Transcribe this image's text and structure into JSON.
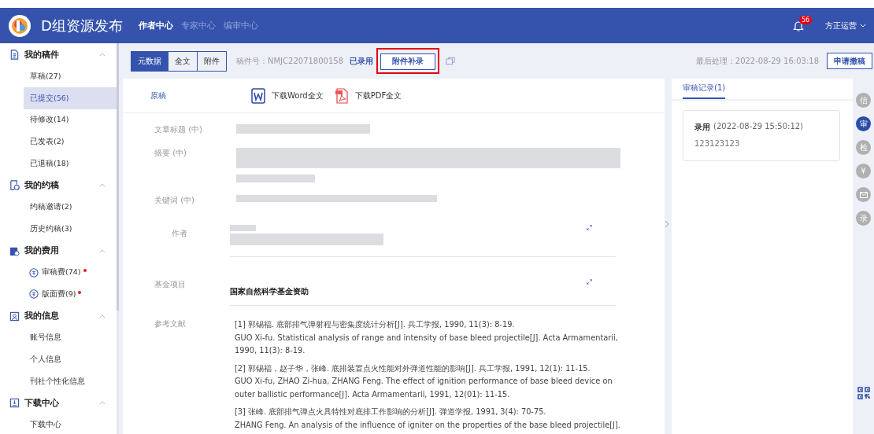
{
  "header": {
    "brand": "D组资源发布",
    "nav": [
      {
        "label": "作者中心",
        "selected": true
      },
      {
        "label": "专家中心",
        "selected": false
      },
      {
        "label": "编审中心",
        "selected": false
      }
    ],
    "notification_count": "56",
    "user": "方正运营"
  },
  "sidebar": {
    "sections": [
      {
        "title": "我的稿件",
        "expanded": true,
        "items": [
          {
            "label": "草稿(27)",
            "kind": "plain",
            "selected": false,
            "alert": false
          },
          {
            "label": "已提交(56)",
            "kind": "plain",
            "selected": true,
            "alert": false
          },
          {
            "label": "待修改(14)",
            "kind": "plain",
            "selected": false,
            "alert": false
          },
          {
            "label": "已发表(2)",
            "kind": "plain",
            "selected": false,
            "alert": false
          },
          {
            "label": "已退稿(18)",
            "kind": "plain",
            "selected": false,
            "alert": false
          }
        ]
      },
      {
        "title": "我的约稿",
        "expanded": true,
        "items": [
          {
            "label": "约稿邀请(2)",
            "kind": "plain",
            "selected": false,
            "alert": false
          },
          {
            "label": "历史约稿(3)",
            "kind": "plain",
            "selected": false,
            "alert": false
          }
        ]
      },
      {
        "title": "我的费用",
        "expanded": true,
        "items": [
          {
            "label": "审稿费(74)",
            "kind": "fee",
            "selected": false,
            "alert": true
          },
          {
            "label": "版面费(9)",
            "kind": "fee",
            "selected": false,
            "alert": true
          }
        ]
      },
      {
        "title": "我的信息",
        "expanded": true,
        "items": [
          {
            "label": "账号信息",
            "kind": "plain",
            "selected": false,
            "alert": false
          },
          {
            "label": "个人信息",
            "kind": "plain",
            "selected": false,
            "alert": false
          },
          {
            "label": "刊社个性化信息",
            "kind": "plain",
            "selected": false,
            "alert": false
          }
        ]
      },
      {
        "title": "下载中心",
        "expanded": true,
        "items": [
          {
            "label": "下载中心",
            "kind": "plain",
            "selected": false,
            "alert": false
          }
        ]
      }
    ]
  },
  "toolbar": {
    "tabs": [
      {
        "label": "元数据",
        "selected": true
      },
      {
        "label": "全文",
        "selected": false
      },
      {
        "label": "附件",
        "selected": false
      }
    ],
    "manuscript_no": "稿件号：NMJC22071800158",
    "status": "已录用",
    "action": {
      "label": "附件补录",
      "highlighted": true
    },
    "last_processed": "最后处理：2022-08-29 16:03:18",
    "withdraw_button": "申请撤稿"
  },
  "document": {
    "section": "原稿",
    "downloads": [
      {
        "label": "下载Word全文",
        "kind": "word"
      },
      {
        "label": "下载PDF全文",
        "kind": "pdf"
      }
    ],
    "fields": [
      {
        "label": "文章标题 (中)",
        "kind": "title"
      },
      {
        "label": "摘要 (中)",
        "kind": "abstract"
      },
      {
        "label": "关键词 (中)",
        "kind": "keywords"
      },
      {
        "label": "作者",
        "kind": "authors"
      }
    ],
    "fund_label": "基金项目",
    "fund": "国家自然科学基金资助",
    "references_label": "参考文献",
    "references": [
      [
        "[1] 郭锡福. 底部排气弹射程与密集度统计分析[J]. 兵工学报, 1990, 11(3): 8-19.",
        "GUO Xi-fu. Statistical analysis of range and intensity of base bleed projectile[J]. Acta Armamentarii, 1990, 11(3): 8-19."
      ],
      [
        "[2] 郭锡福，赵子华，张峰. 底排装置点火性能对外弹道性能的影响[J]. 兵工学报, 1991, 12(1): 11-15.",
        "GUO Xi-fu, ZHAO Zi-hua, ZHANG Feng. The effect of ignition performance of base bleed device on outer ballistic performance[J]. Acta Armamentarii, 1991, 12(01): 11-15."
      ],
      [
        "[3] 张峰. 底部排气弹点火具特性对底排工作影响的分析[J]. 弹道学报, 1991, 3(4): 70-75.",
        "ZHANG Feng. An analysis of the influence of igniter on the properties of the base bleed projectile[J]."
      ]
    ]
  },
  "review": {
    "tab": "审稿记录(1)",
    "records": [
      {
        "decision": "录用",
        "time": "(2022-08-29 15:50:12)",
        "comment": "123123123"
      }
    ]
  },
  "rail": [
    {
      "kind": "text",
      "label": "信",
      "selected": false
    },
    {
      "kind": "text",
      "label": "审",
      "selected": true
    },
    {
      "kind": "text",
      "label": "检",
      "selected": false
    },
    {
      "kind": "text",
      "label": "¥",
      "selected": false
    },
    {
      "kind": "mail",
      "selected": false
    },
    {
      "kind": "text",
      "label": "录",
      "selected": false
    }
  ]
}
